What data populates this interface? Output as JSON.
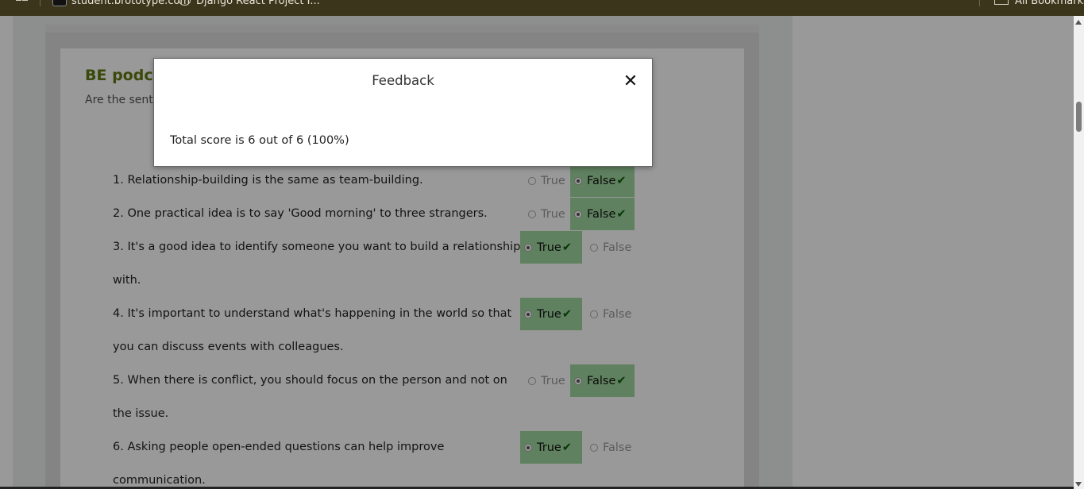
{
  "bookmarks": {
    "items": [
      {
        "label": "student.brototype.com"
      },
      {
        "label": "Django React Project I..."
      }
    ],
    "all_bookmarks": "All Bookmarks"
  },
  "activity": {
    "title": "BE podca",
    "subtitle": "Are the sent",
    "option_true": "True",
    "option_false": "False",
    "check": "✔",
    "questions": [
      {
        "text": "1. Relationship-building is the same as team-building.",
        "answer": "False"
      },
      {
        "text": "2. One practical idea is to say 'Good morning' to three strangers.",
        "answer": "False"
      },
      {
        "text": "3. It's a good idea to identify someone you want to build a relationship with.",
        "answer": "True"
      },
      {
        "text": "4. It's important to understand what's happening in the world so that you can discuss events with colleagues.",
        "answer": "True"
      },
      {
        "text": "5. When there is conflict, you should focus on the person and not on the issue.",
        "answer": "False"
      },
      {
        "text": "6. Asking people open-ended questions can help improve communication.",
        "answer": "True"
      }
    ]
  },
  "modal": {
    "title": "Feedback",
    "close": "✕",
    "score_text": "Total score is 6 out of 6 (100%)"
  },
  "colors": {
    "title_green": "#5f7a12",
    "correct_bg": "#9fd89f",
    "check_green": "#0b5b0b"
  }
}
